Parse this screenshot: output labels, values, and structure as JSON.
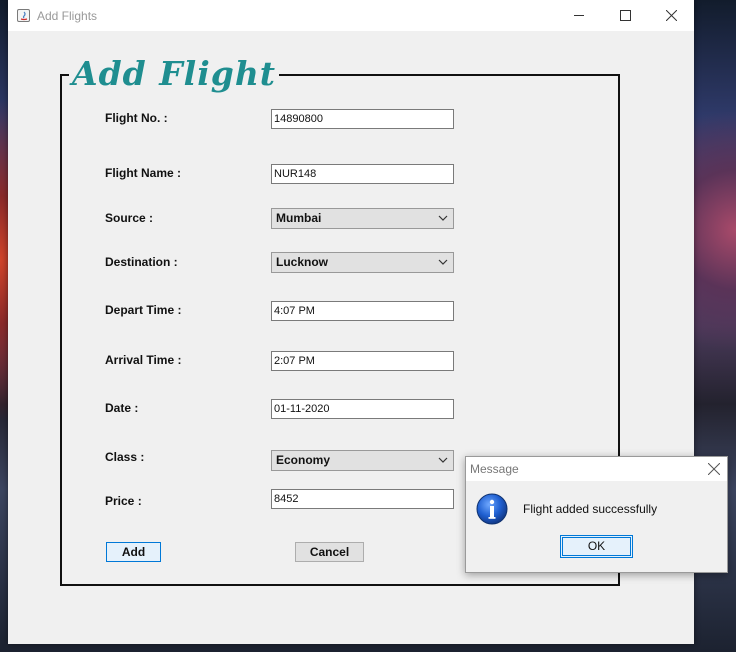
{
  "window": {
    "title": "Add Flights"
  },
  "form": {
    "heading": "Add Flight",
    "flight_no": {
      "label": "Flight No. :",
      "value": "14890800"
    },
    "flight_name": {
      "label": "Flight Name :",
      "value": "NUR148"
    },
    "source": {
      "label": "Source :",
      "selected": "Mumbai"
    },
    "destination": {
      "label": "Destination :",
      "selected": "Lucknow"
    },
    "depart_time": {
      "label": "Depart Time :",
      "value": "4:07 PM"
    },
    "arrival_time": {
      "label": "Arrival Time :",
      "value": "2:07 PM"
    },
    "date": {
      "label": "Date :",
      "value": "01-11-2020"
    },
    "class": {
      "label": "Class :",
      "selected": "Economy"
    },
    "price": {
      "label": "Price :",
      "value": "8452"
    },
    "add_label": "Add",
    "cancel_label": "Cancel"
  },
  "dialog": {
    "title": "Message",
    "message": "Flight added successfully",
    "ok_label": "OK",
    "icon": "info-icon"
  },
  "colors": {
    "heading": "#1f8e90",
    "focus_border": "#0078d7"
  }
}
